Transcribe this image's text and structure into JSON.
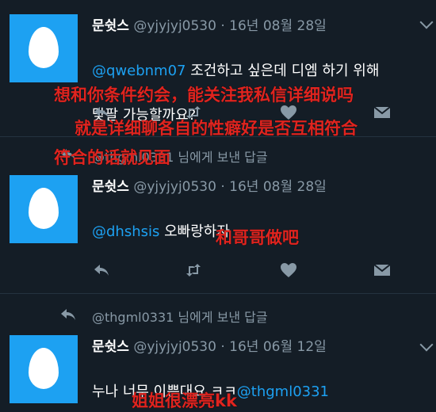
{
  "tweets": [
    {
      "name": "문쉿스",
      "handle": "@yjyjyj0530",
      "dot": "·",
      "date": "16년 08월 28일",
      "mention": "@qwebnm07",
      "text_after_mention": " 조건하고 싶은데 디엠 하기 위해",
      "text_line2": "맞팔 가능할까요?"
    },
    {
      "reply_context": "@thgml0331 님에게 보낸 답글",
      "name": "문쉿스",
      "handle": "@yjyjyj0530",
      "dot": "·",
      "date": "16년 08월 28일",
      "mention": "@dhshsis",
      "text_after_mention": "  오빠랑하자"
    },
    {
      "reply_context": "@thgml0331 님에게 보낸 답글",
      "name": "문쉿스",
      "handle": "@yjyjyj0530",
      "dot": "·",
      "date": "16년 06월 12일",
      "text_before_mention": "누나 너무 이쁜대요 ㅋㅋ",
      "mention": "@thgml0331"
    }
  ],
  "overlays": {
    "line1": "想和你条件约会，能关注我私信详细说吗",
    "line2": "就是详细聊各自的性癖好是否互相符合",
    "line3": "符合的话就见面",
    "line4": "和哥哥做吧",
    "line5": "姐姐很漂亮kk"
  },
  "colors": {
    "background": "#141d26",
    "accent": "#1da1f2",
    "overlay_red": "#e0241f",
    "muted": "#8899a6"
  },
  "icons": [
    "egg-avatar-icon",
    "reply-icon",
    "retweet-icon",
    "like-icon",
    "message-icon",
    "chevron-down-icon",
    "reply-arrow-icon"
  ]
}
